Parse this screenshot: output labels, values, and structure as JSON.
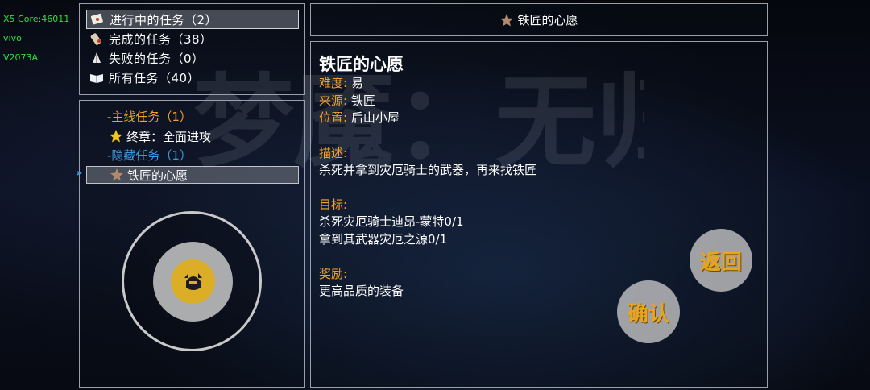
{
  "debug": {
    "core": "X5 Core:46011",
    "brand": "vivo",
    "model": "V2073A"
  },
  "filters": [
    {
      "label": "进行中的任务（2）",
      "icon": "scroll-note-icon",
      "selected": true
    },
    {
      "label": "完成的任务（38）",
      "icon": "parchment-icon",
      "selected": false
    },
    {
      "label": "失败的任务（0）",
      "icon": "broken-arrow-icon",
      "selected": false
    },
    {
      "label": "所有任务（40）",
      "icon": "open-book-icon",
      "selected": false
    }
  ],
  "tree": {
    "main_category": "-主线任务（1）",
    "main_quest": "终章：全面进攻",
    "hidden_category": "-隐藏任务（1）",
    "hidden_quest": "铁匠的心愿"
  },
  "header": {
    "title": "铁匠的心愿"
  },
  "detail": {
    "title": "铁匠的心愿",
    "difficulty_label": "难度:",
    "difficulty": "易",
    "source_label": "来源:",
    "source": "铁匠",
    "location_label": "位置:",
    "location": "后山小屋",
    "description_label": "描述:",
    "description": "杀死并拿到灾厄骑士的武器，再来找铁匠",
    "objective_label": "目标:",
    "objective_1": "杀死灾厄骑士迪昂-蒙特0/1",
    "objective_2": "拿到其武器灾厄之源0/1",
    "reward_label": "奖励:",
    "reward": "更高品质的装备"
  },
  "buttons": {
    "back": "返回",
    "confirm": "确认"
  },
  "background_text": "梦魇：无归",
  "colors": {
    "category_orange": "#f2a22c",
    "hidden_blue": "#3d9be0",
    "button_text": "#e8a31f",
    "debug_green": "#2fe03a"
  }
}
